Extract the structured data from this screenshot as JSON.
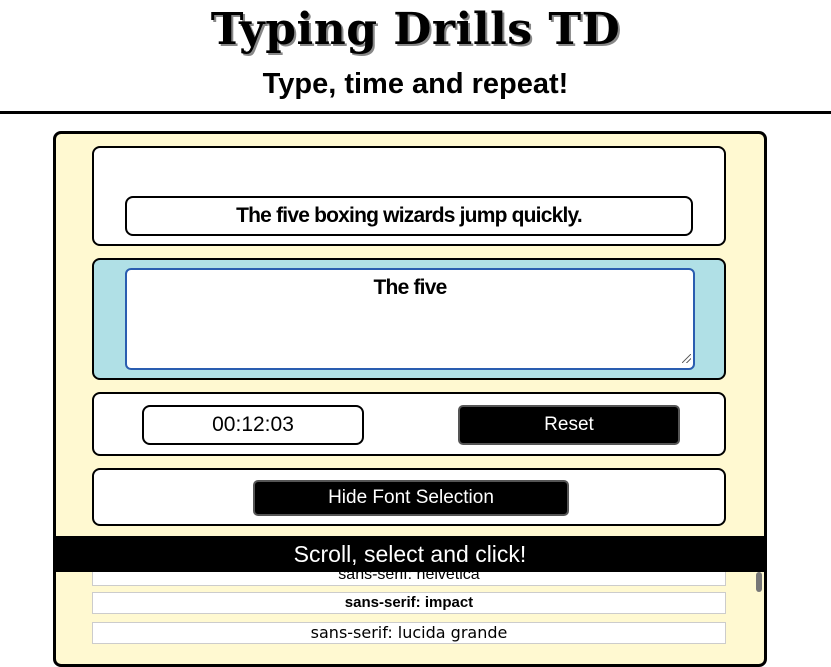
{
  "header": {
    "title": "Typing Drills TD",
    "subtitle": "Type, time and repeat!"
  },
  "drill": {
    "target_sentence": "The five boxing wizards jump quickly.",
    "typed_text": "The five"
  },
  "timer": {
    "display": "00:12:03"
  },
  "controls": {
    "reset_label": "Reset",
    "font_toggle_label": "Hide Font Selection"
  },
  "font_selector": {
    "banner": "Scroll, select and click!",
    "options": [
      "sans-serif: helvetica",
      "sans-serif: impact",
      "sans-serif: lucida grande"
    ]
  },
  "colors": {
    "panel_background": "#fff9d1",
    "input_card_background": "#b0e0e6",
    "button_background": "#000000"
  }
}
